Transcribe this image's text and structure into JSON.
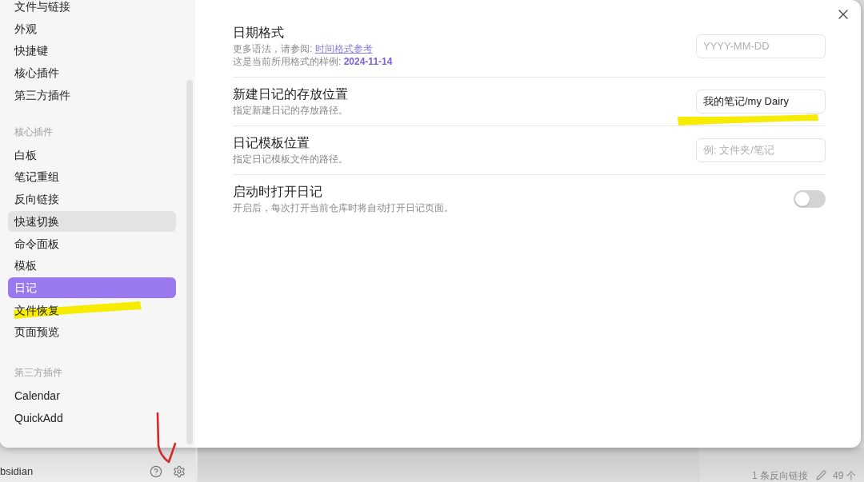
{
  "sidebar": {
    "groups": [
      {
        "items": [
          {
            "label": "文件与链接",
            "selected": false,
            "hovered": false,
            "annotated": false
          },
          {
            "label": "外观",
            "selected": false,
            "hovered": false,
            "annotated": false
          },
          {
            "label": "快捷键",
            "selected": false,
            "hovered": false,
            "annotated": false
          },
          {
            "label": "核心插件",
            "selected": false,
            "hovered": false,
            "annotated": false
          },
          {
            "label": "第三方插件",
            "selected": false,
            "hovered": false,
            "annotated": false
          }
        ]
      },
      {
        "heading": "核心插件",
        "items": [
          {
            "label": "白板",
            "selected": false,
            "hovered": false,
            "annotated": false
          },
          {
            "label": "笔记重组",
            "selected": false,
            "hovered": false,
            "annotated": false
          },
          {
            "label": "反向链接",
            "selected": false,
            "hovered": false,
            "annotated": false
          },
          {
            "label": "快速切换",
            "selected": false,
            "hovered": true,
            "annotated": false
          },
          {
            "label": "命令面板",
            "selected": false,
            "hovered": false,
            "annotated": false
          },
          {
            "label": "模板",
            "selected": false,
            "hovered": false,
            "annotated": false
          },
          {
            "label": "日记",
            "selected": true,
            "hovered": false,
            "annotated": false
          },
          {
            "label": "文件恢复",
            "selected": false,
            "hovered": false,
            "annotated": true
          },
          {
            "label": "页面预览",
            "selected": false,
            "hovered": false,
            "annotated": false
          }
        ]
      },
      {
        "heading": "第三方插件",
        "items": [
          {
            "label": "Calendar",
            "selected": false,
            "hovered": false,
            "annotated": false
          },
          {
            "label": "QuickAdd",
            "selected": false,
            "hovered": false,
            "annotated": false
          }
        ]
      }
    ]
  },
  "settings": [
    {
      "title": "日期格式",
      "description": [
        {
          "text": "更多语法，请参阅: ",
          "link": "时间格式参考"
        },
        {
          "text": "这是当前所用格式的样例: **2024-11-14**"
        }
      ],
      "control": {
        "kind": "text",
        "placeholder": "YYYY-MM-DD"
      },
      "annotated": false
    },
    {
      "title": "新建日记的存放位置",
      "description": [
        {
          "text": "指定新建日记的存放路径。"
        }
      ],
      "control": {
        "kind": "text",
        "value": "我的笔记/my Dairy"
      },
      "annotated": true
    },
    {
      "title": "日记模板位置",
      "description": [
        {
          "text": "指定日记模板文件的路径。"
        }
      ],
      "control": {
        "kind": "text",
        "placeholder": "例: 文件夹/笔记"
      },
      "annotated": false
    },
    {
      "title": "启动时打开日记",
      "description": [
        {
          "text": "开启后，每次打开当前仓库时将自动打开日记页面。"
        }
      ],
      "control": {
        "kind": "toggle",
        "on": false
      },
      "annotated": false
    }
  ],
  "vault_bar": {
    "name": "bsidian",
    "settings_annotated": true
  },
  "status_bar": {
    "backlinks": "1 条反向链接",
    "count": "49 个"
  }
}
